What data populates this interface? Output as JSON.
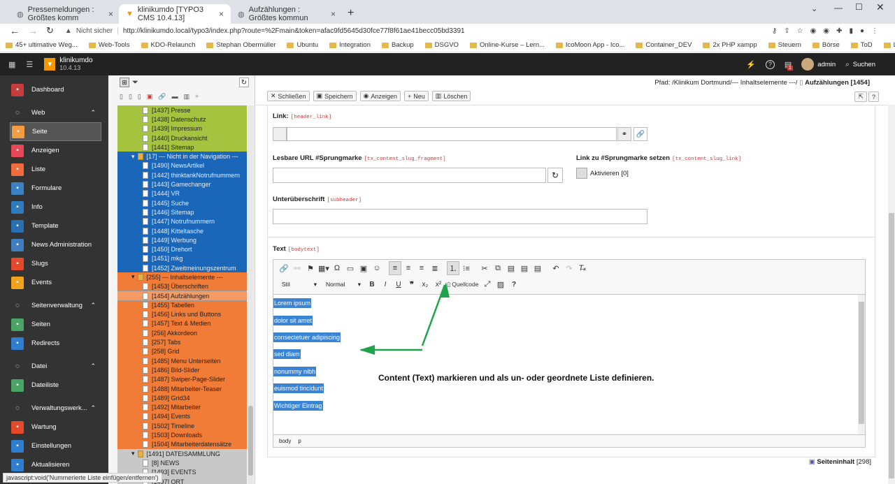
{
  "browser": {
    "tabs": [
      {
        "label": "Pressemeldungen : Größtes komm",
        "active": false
      },
      {
        "label": "klinikumdo [TYPO3 CMS 10.4.13]",
        "active": true
      },
      {
        "label": "Aufzählungen : Größtes kommun",
        "active": false
      }
    ],
    "new_tab": "+",
    "security": "Nicht sicher",
    "url": "http://klinikumdo.local/typo3/index.php?route=%2Fmain&token=afac9fd5645d30fce77f8f61ae41becc05bd3391",
    "bookmarks": [
      "45+ ultimative Weg...",
      "Web-Tools",
      "KDO-Relaunch",
      "Stephan Obermüller",
      "Ubuntu",
      "Integration",
      "Backup",
      "DSGVO",
      "Online-Kurse – Lern...",
      "IcoMoon App - Ico...",
      "Container_DEV",
      "2x PHP xampp",
      "Steuern",
      "Börse",
      "ToD",
      "Lodash / Javascript-..."
    ]
  },
  "typo3": {
    "site_name": "klinikumdo",
    "version": "10.4.13",
    "user": "admin",
    "search": "Suchen",
    "notification_count": "1"
  },
  "modules": [
    {
      "type": "item",
      "label": "Dashboard",
      "color": "#c83c3c",
      "icon": "dashboard-icon"
    },
    {
      "type": "head",
      "label": "Web",
      "icon": "web-icon"
    },
    {
      "type": "item",
      "label": "Seite",
      "color": "#f49d40",
      "icon": "page-icon",
      "active": true
    },
    {
      "type": "item",
      "label": "Anzeigen",
      "color": "#e74856",
      "icon": "eye-icon"
    },
    {
      "type": "item",
      "label": "Liste",
      "color": "#f16c3d",
      "icon": "list-icon"
    },
    {
      "type": "item",
      "label": "Formulare",
      "color": "#3a82c4",
      "icon": "form-icon"
    },
    {
      "type": "item",
      "label": "Info",
      "color": "#2d7cc0",
      "icon": "info-icon"
    },
    {
      "type": "item",
      "label": "Template",
      "color": "#2a6fb3",
      "icon": "template-icon"
    },
    {
      "type": "item",
      "label": "News Administration",
      "color": "#3f7fbf",
      "icon": "news-icon"
    },
    {
      "type": "item",
      "label": "Slugs",
      "color": "#e5492a",
      "icon": "slug-icon"
    },
    {
      "type": "item",
      "label": "Events",
      "color": "#f4a21b",
      "icon": "calendar-icon"
    },
    {
      "type": "head",
      "label": "Seitenverwaltung",
      "icon": "globe-icon"
    },
    {
      "type": "item",
      "label": "Seiten",
      "color": "#4aa564",
      "icon": "pages-icon"
    },
    {
      "type": "item",
      "label": "Redirects",
      "color": "#2f7dd0",
      "icon": "redirect-icon"
    },
    {
      "type": "head",
      "label": "Datei",
      "icon": "file-icon"
    },
    {
      "type": "item",
      "label": "Dateiliste",
      "color": "#4aa564",
      "icon": "filelist-icon"
    },
    {
      "type": "head",
      "label": "Verwaltungswerk...",
      "icon": "rocket-icon"
    },
    {
      "type": "item",
      "label": "Wartung",
      "color": "#e5492a",
      "icon": "wrench-icon"
    },
    {
      "type": "item",
      "label": "Einstellungen",
      "color": "#2f7dd0",
      "icon": "gear-icon"
    },
    {
      "type": "item",
      "label": "Aktualisieren",
      "color": "#2f7dd0",
      "icon": "update-icon"
    }
  ],
  "tree": [
    {
      "label": "[1437] Presse",
      "bg": "#a5c33f"
    },
    {
      "label": "[1438] Datenschutz",
      "bg": "#a5c33f"
    },
    {
      "label": "[1439] Impressum",
      "bg": "#a5c33f"
    },
    {
      "label": "[1440] Druckansicht",
      "bg": "#a5c33f"
    },
    {
      "label": "[1441] Sitemap",
      "bg": "#a5c33f"
    },
    {
      "label": "[17] --- Nicht in der Navigation ---",
      "bg": "#1a66b8",
      "folder": true
    },
    {
      "label": "[1490] NewsArtikel",
      "bg": "#1a66b8"
    },
    {
      "label": "[1442] thinktankNotrufnummern",
      "bg": "#1a66b8"
    },
    {
      "label": "[1443] Gamechanger",
      "bg": "#1a66b8"
    },
    {
      "label": "[1444] VR",
      "bg": "#1a66b8"
    },
    {
      "label": "[1445] Suche",
      "bg": "#1a66b8"
    },
    {
      "label": "[1446] Sitemap",
      "bg": "#1a66b8"
    },
    {
      "label": "[1447] Notrufnummern",
      "bg": "#1a66b8"
    },
    {
      "label": "[1448] Kitteltasche",
      "bg": "#1a66b8"
    },
    {
      "label": "[1449] Werbung",
      "bg": "#1a66b8"
    },
    {
      "label": "[1450] Drehort",
      "bg": "#1a66b8"
    },
    {
      "label": "[1451] mkg",
      "bg": "#1a66b8"
    },
    {
      "label": "[1452] Zweitmeinungszentrum",
      "bg": "#1a66b8"
    },
    {
      "label": "[255] --- Inhaltselemente ---",
      "bg": "#f07c37",
      "folder": true
    },
    {
      "label": "[1453] Überschriften",
      "bg": "#f07c37"
    },
    {
      "label": "[1454] Aufzählungen",
      "bg": "#f07c37",
      "selected": true
    },
    {
      "label": "[1455] Tabellen",
      "bg": "#f07c37"
    },
    {
      "label": "[1456] Links und Buttons",
      "bg": "#f07c37"
    },
    {
      "label": "[1457] Text & Medien",
      "bg": "#f07c37"
    },
    {
      "label": "[256] Akkordeon",
      "bg": "#f07c37"
    },
    {
      "label": "[257] Tabs",
      "bg": "#f07c37"
    },
    {
      "label": "[258] Grid",
      "bg": "#f07c37"
    },
    {
      "label": "[1485] Menu Unterseiten",
      "bg": "#f07c37"
    },
    {
      "label": "[1486] Bild-Slider",
      "bg": "#f07c37"
    },
    {
      "label": "[1487] Swiper-Page-Slider",
      "bg": "#f07c37"
    },
    {
      "label": "[1488] Mitarbeiter-Teaser",
      "bg": "#f07c37"
    },
    {
      "label": "[1489] Grid34",
      "bg": "#f07c37"
    },
    {
      "label": "[1492] Mitarbeiter",
      "bg": "#f07c37"
    },
    {
      "label": "[1494] Events",
      "bg": "#f07c37"
    },
    {
      "label": "[1502] Timeline",
      "bg": "#f07c37"
    },
    {
      "label": "[1503] Downloads",
      "bg": "#f07c37"
    },
    {
      "label": "[1504] Mitarbeiterdatensätze",
      "bg": "#f07c37"
    },
    {
      "label": "[1491] DATEISAMMLUNG",
      "bg": "#c8c8c8",
      "folder": true
    },
    {
      "label": "[8] NEWS",
      "bg": "#c8c8c8"
    },
    {
      "label": "[1493] EVENTS",
      "bg": "#c8c8c8"
    },
    {
      "label": "[1497] ORT",
      "bg": "#c8c8c8"
    }
  ],
  "docheader": {
    "close": "Schließen",
    "save": "Speichern",
    "view": "Anzeigen",
    "new": "Neu",
    "delete": "Löschen",
    "path_label": "Pfad: /Klinikum Dortmund/--- Inhaltselemente ---/",
    "page_title": "Aufzählungen [1454]"
  },
  "form": {
    "link_label": "Link:",
    "link_code": "[header_link]",
    "slug_label": "Lesbare URL #Sprungmarke",
    "slug_code": "[tx_content_slug_fragment]",
    "slug_link_label": "Link zu #Sprungmarke setzen",
    "slug_link_code": "[tx_content_slug_link]",
    "activate_label": "Aktivieren [0]",
    "subheader_label": "Unterüberschrift",
    "subheader_code": "[subheader]",
    "text_label": "Text",
    "text_code": "[bodytext]"
  },
  "editor": {
    "style_select": "Stil",
    "format_select": "Normal",
    "source_label": "Quellcode",
    "path_body": "body",
    "path_p": "p",
    "lines": [
      "Lorem ipsum",
      "dolor sit amet",
      "consectetuer adipiscing",
      "sed diam",
      "nonummy nibh",
      "euismod tincidunt",
      "Wichtiger Eintrag"
    ]
  },
  "annotation": "Content (Text) markieren und als un- oder geordnete Liste definieren.",
  "footer": {
    "record": "Seiteninhalt",
    "record_id": "[298]"
  },
  "statusbar": "javascript:void('Nummerierte Liste einfügen/entfernen')"
}
